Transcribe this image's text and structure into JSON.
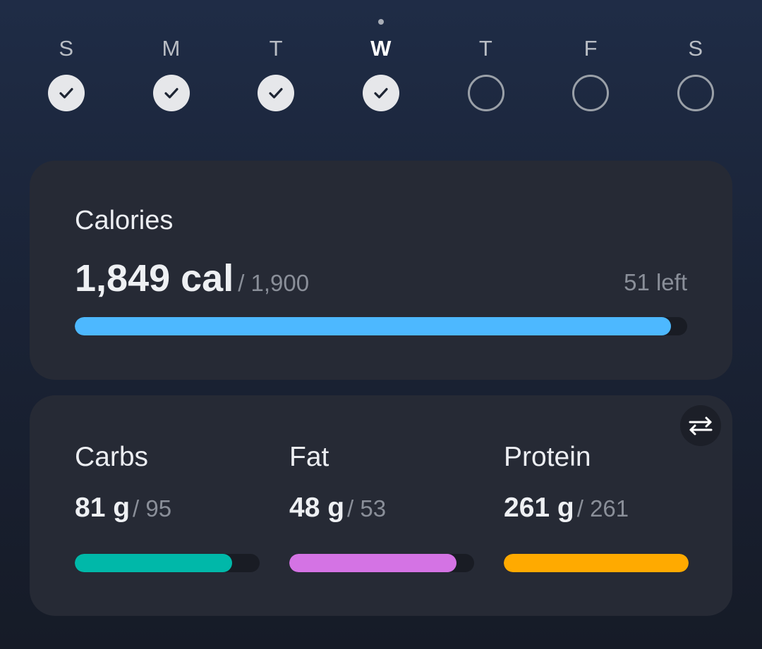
{
  "week": {
    "days": [
      {
        "letter": "S",
        "status": "done",
        "current": false
      },
      {
        "letter": "M",
        "status": "done",
        "current": false
      },
      {
        "letter": "T",
        "status": "done",
        "current": false
      },
      {
        "letter": "W",
        "status": "done",
        "current": true
      },
      {
        "letter": "T",
        "status": "pending",
        "current": false
      },
      {
        "letter": "F",
        "status": "pending",
        "current": false
      },
      {
        "letter": "S",
        "status": "pending",
        "current": false
      }
    ],
    "icons": {
      "done": "check-icon",
      "pending": "empty-circle-icon",
      "today": "today-dot"
    }
  },
  "calories": {
    "title": "Calories",
    "consumed": "1,849 cal",
    "goal": "/ 1,900",
    "remaining": "51 left",
    "progress": 0.973,
    "bar_color": "#4db8ff"
  },
  "macros": {
    "swap_icon": "swap-arrows-icon",
    "items": [
      {
        "key": "carbs",
        "title": "Carbs",
        "consumed": "81 g",
        "goal": "/ 95",
        "progress": 0.853,
        "color": "#00b8a9"
      },
      {
        "key": "fat",
        "title": "Fat",
        "consumed": "48 g",
        "goal": "/ 53",
        "progress": 0.906,
        "color": "#d473e4"
      },
      {
        "key": "protein",
        "title": "Protein",
        "consumed": "261 g",
        "goal": "/ 261",
        "progress": 1.0,
        "color": "#ffaa00"
      }
    ]
  },
  "colors": {
    "card_bg": "#262a35",
    "track_bg": "#191c24",
    "muted_text": "#8a8f99"
  }
}
